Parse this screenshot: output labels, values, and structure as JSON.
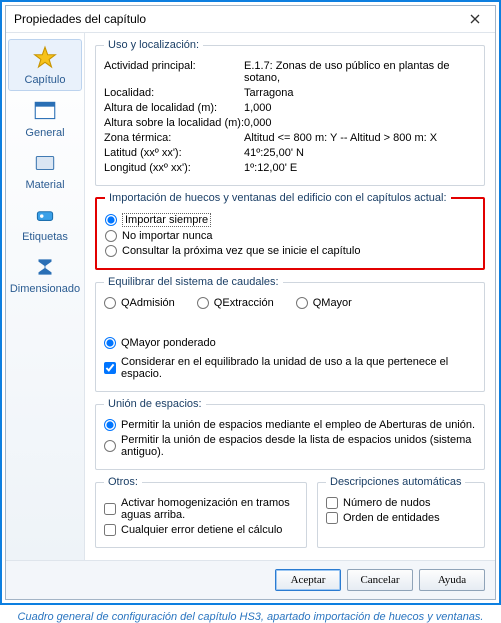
{
  "window": {
    "title": "Propiedades del capítulo"
  },
  "sidebar": {
    "items": [
      {
        "label": "Capítulo"
      },
      {
        "label": "General"
      },
      {
        "label": "Material"
      },
      {
        "label": "Etiquetas"
      },
      {
        "label": "Dimensionado"
      }
    ]
  },
  "uso": {
    "legend": "Uso y localización:",
    "rows": [
      {
        "k": "Actividad principal:",
        "v": "E.1.7: Zonas de uso público en plantas de sotano,"
      },
      {
        "k": "Localidad:",
        "v": "Tarragona"
      },
      {
        "k": "Altura de localidad (m):",
        "v": "1,000"
      },
      {
        "k": "Altura sobre la localidad (m):",
        "v": "0,000"
      },
      {
        "k": "Zona térmica:",
        "v": "Altitud <= 800 m: Y -- Altitud > 800 m: X"
      },
      {
        "k": "Latitud (xxº xx'):",
        "v": "41º:25,00' N"
      },
      {
        "k": "Longitud (xxº xx'):",
        "v": "1º:12,00' E"
      }
    ]
  },
  "import": {
    "legend": "Importación de huecos y ventanas del edificio con el capítulos actual:",
    "opts": [
      "Importar siempre",
      "No importar nunca",
      "Consultar la próxima vez que se inicie el capítulo"
    ],
    "selected": 0
  },
  "caudales": {
    "legend": "Equilibrar del sistema de caudales:",
    "opts": [
      "QAdmisión",
      "QExtracción",
      "QMayor",
      "QMayor ponderado"
    ],
    "selected": 3,
    "chk": "Considerar en el equilibrado la unidad de uso a la que pertenece el espacio.",
    "chk_checked": true
  },
  "union": {
    "legend": "Unión de espacios:",
    "opts": [
      "Permitir la unión de espacios mediante el empleo de Aberturas de unión.",
      "Permitir la unión de espacios desde la lista de espacios unidos (sistema antiguo)."
    ],
    "selected": 0
  },
  "otros": {
    "legend": "Otros:",
    "chk1": "Activar homogenización en tramos aguas arriba.",
    "chk2": "Cualquier error detiene el cálculo"
  },
  "desc": {
    "legend": "Descripciones automáticas",
    "chk1": "Número de nudos",
    "chk2": "Orden de entidades"
  },
  "buttons": {
    "ok": "Aceptar",
    "cancel": "Cancelar",
    "help": "Ayuda"
  },
  "caption": "Cuadro general de configuración del capítulo HS3, apartado importación de huecos y ventanas."
}
